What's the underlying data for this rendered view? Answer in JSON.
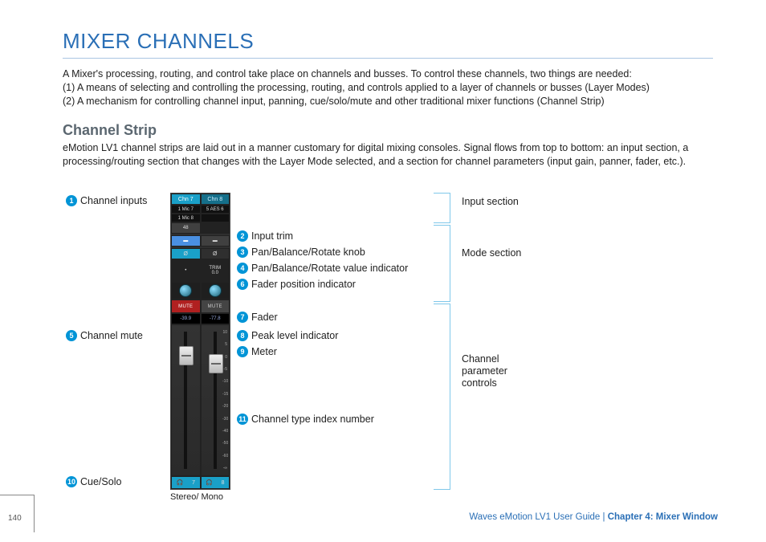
{
  "title": "MIXER CHANNELS",
  "intro": {
    "p1": "A Mixer's processing, routing, and control take place on channels and busses. To control these channels, two things are needed:",
    "p2": "(1) A means of selecting and controlling the processing, routing, and controls applied to a layer of channels or busses (Layer Modes)",
    "p3": "(2) A mechanism for controlling channel input, panning, cue/solo/mute and other traditional mixer functions (Channel Strip)"
  },
  "section": {
    "title": "Channel Strip",
    "body": "eMotion LV1 channel strips are laid out in a manner customary for digital mixing consoles. Signal flows from top to bottom: an input section, a processing/routing section that changes with the Layer Mode selected, and a section for channel parameters (input gain, panner, fader, etc.)."
  },
  "callouts_left": {
    "n1": "1",
    "t1": "Channel inputs",
    "n5": "5",
    "t5": "Channel mute",
    "n10": "10",
    "t10": "Cue/Solo"
  },
  "callouts_right": {
    "n2": "2",
    "t2": "Input trim",
    "n3": "3",
    "t3": "Pan/Balance/Rotate knob",
    "n4": "4",
    "t4": "Pan/Balance/Rotate value indicator",
    "n6": "6",
    "t6": "Fader position indicator",
    "n7": "7",
    "t7": "Fader",
    "n8": "8",
    "t8": "Peak level indicator",
    "n9": "9",
    "t9": "Meter",
    "n11": "11",
    "t11": "Channel type index number"
  },
  "brackets": {
    "b1": "Input section",
    "b2": "Mode section",
    "b3": "Channel parameter controls"
  },
  "strip": {
    "ch7": "Chn 7",
    "ch8": "Chn 8",
    "mic7a": "1 Mic 7",
    "mic7b": "1 Mic 8",
    "aes": "5  AES 6",
    "fortyeight": "48",
    "phase": "Ø",
    "trim_label": "TRIM",
    "trim_val": "0.0",
    "mute_on": "MUTE",
    "mute_off": "MUTE",
    "lvl7": "-39.9",
    "lvl8": "-77.8",
    "ticks": [
      "10",
      "5",
      "0",
      "-5",
      "-10",
      "-15",
      "-20",
      "-30",
      "-40",
      "-50",
      "-60",
      "-∞"
    ],
    "solo7": "7",
    "solo8": "8",
    "headphone": "♒"
  },
  "foot_caption": "Stereo/ Mono",
  "footer": {
    "guide": "Waves eMotion LV1 User Guide ",
    "sep": "| ",
    "chapter": "Chapter 4: Mixer Window"
  },
  "page_number": "140"
}
